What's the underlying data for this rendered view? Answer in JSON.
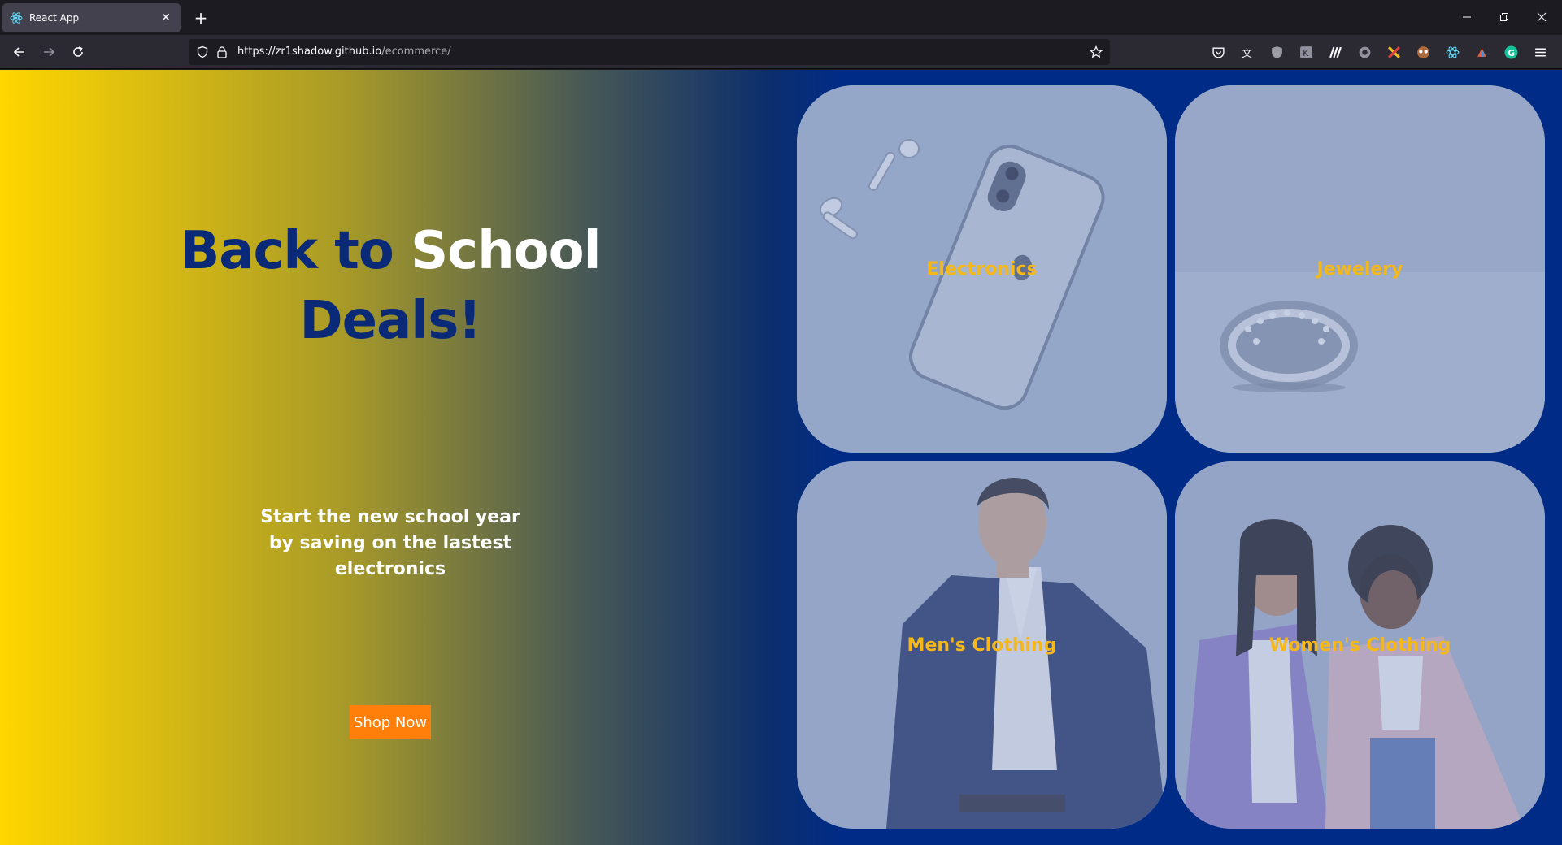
{
  "browser": {
    "tab_title": "React App",
    "tab_close": "✕",
    "new_tab": "+",
    "url_host": "https://zr1shadow.github.io",
    "url_path": "/ecommerce/"
  },
  "hero": {
    "headline_part1": "Back to",
    "headline_part2": "School",
    "headline_part3": "Deals!",
    "subtext": "Start the new school year by saving on the lastest electronics",
    "cta_label": "Shop Now"
  },
  "categories": [
    {
      "label": "Electronics"
    },
    {
      "label": "Jewelery"
    },
    {
      "label": "Men's Clothing"
    },
    {
      "label": "Women's Clothing"
    }
  ],
  "colors": {
    "accent_label": "#f5b81a",
    "cta": "#ff7f0a",
    "headline_blue": "#0a2a78",
    "page_blue": "#002b87",
    "gradient_start": "#ffd600"
  }
}
